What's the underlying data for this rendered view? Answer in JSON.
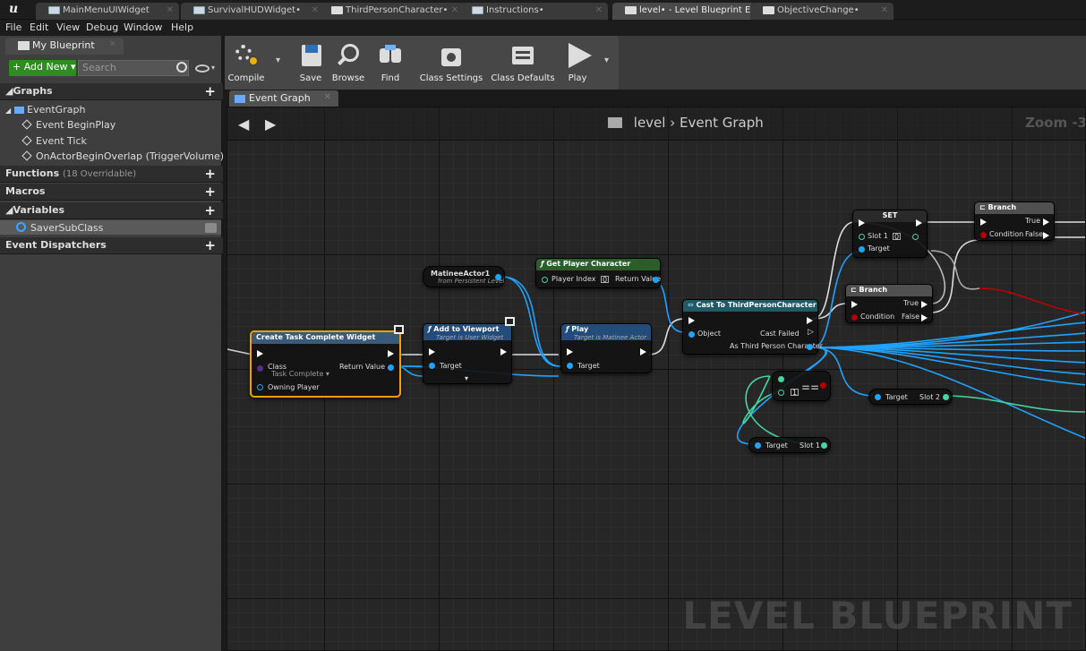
{
  "tabs": [
    {
      "label": "MainMenuUIWidget",
      "active": false
    },
    {
      "label": "SurvivalHUDWidget•",
      "active": false
    },
    {
      "label": "ThirdPersonCharacter•",
      "active": false
    },
    {
      "label": "Instructions•",
      "active": false
    },
    {
      "label": "level• - Level Blueprint Edi",
      "active": true
    },
    {
      "label": "ObjectiveChange•",
      "active": false
    }
  ],
  "menu": [
    "File",
    "Edit",
    "View",
    "Debug",
    "Window",
    "Help"
  ],
  "left_panel": {
    "tab_label": "My Blueprint",
    "add_new_label": "+ Add New ▾",
    "search_placeholder": "Search",
    "sections": {
      "graphs": "Graphs",
      "functions": "Functions",
      "functions_sub": "(18 Overridable)",
      "macros": "Macros",
      "variables": "Variables",
      "event_dispatchers": "Event Dispatchers"
    },
    "graph_tree": {
      "root": "EventGraph",
      "items": [
        "Event BeginPlay",
        "Event Tick",
        "OnActorBeginOverlap (TriggerVolume)"
      ]
    },
    "variables": [
      "SaverSubClass"
    ]
  },
  "toolbar": {
    "compile": "Compile",
    "save": "Save",
    "browse": "Browse",
    "find": "Find",
    "class_settings": "Class Settings",
    "class_defaults": "Class Defaults",
    "play": "Play"
  },
  "graph": {
    "tab_label": "Event Graph",
    "breadcrumb_root": "level",
    "breadcrumb_sep": "›",
    "breadcrumb_leaf": "Event Graph",
    "zoom": "Zoom -3",
    "watermark": "LEVEL BLUEPRINT",
    "nodes": {
      "create_widget": {
        "title": "Create Task Complete Widget",
        "class_label": "Class",
        "class_value": "Task Complete ▾",
        "return_label": "Return Value",
        "owning_label": "Owning Player"
      },
      "add_viewport": {
        "title": "Add to Viewport",
        "sub": "Target is User Widget",
        "target": "Target"
      },
      "matinee": {
        "title": "MatineeActor1",
        "sub": "from Persistent Level"
      },
      "play": {
        "title": "Play",
        "sub": "Target is Matinee Actor",
        "target": "Target"
      },
      "get_player": {
        "title": "Get Player Character",
        "player_index": "Player Index",
        "index_val": "0",
        "return_label": "Return Value"
      },
      "cast": {
        "title": "Cast To ThirdPersonCharacter",
        "object": "Object",
        "failed": "Cast Failed",
        "as_label": "As Third Person Character"
      },
      "set": {
        "title": "SET",
        "slot": "Slot 1",
        "slot_val": "0",
        "target": "Target"
      },
      "branch1": {
        "title": "Branch",
        "true": "True",
        "false": "False",
        "condition": "Condition"
      },
      "branch2": {
        "title": "Branch",
        "true": "True",
        "false": "False",
        "condition": "Condition"
      },
      "equal": {
        "val": "1"
      },
      "get_slot2": {
        "target": "Target",
        "slot": "Slot 2"
      },
      "get_slot1": {
        "target": "Target",
        "slot": "Slot 1"
      }
    }
  }
}
